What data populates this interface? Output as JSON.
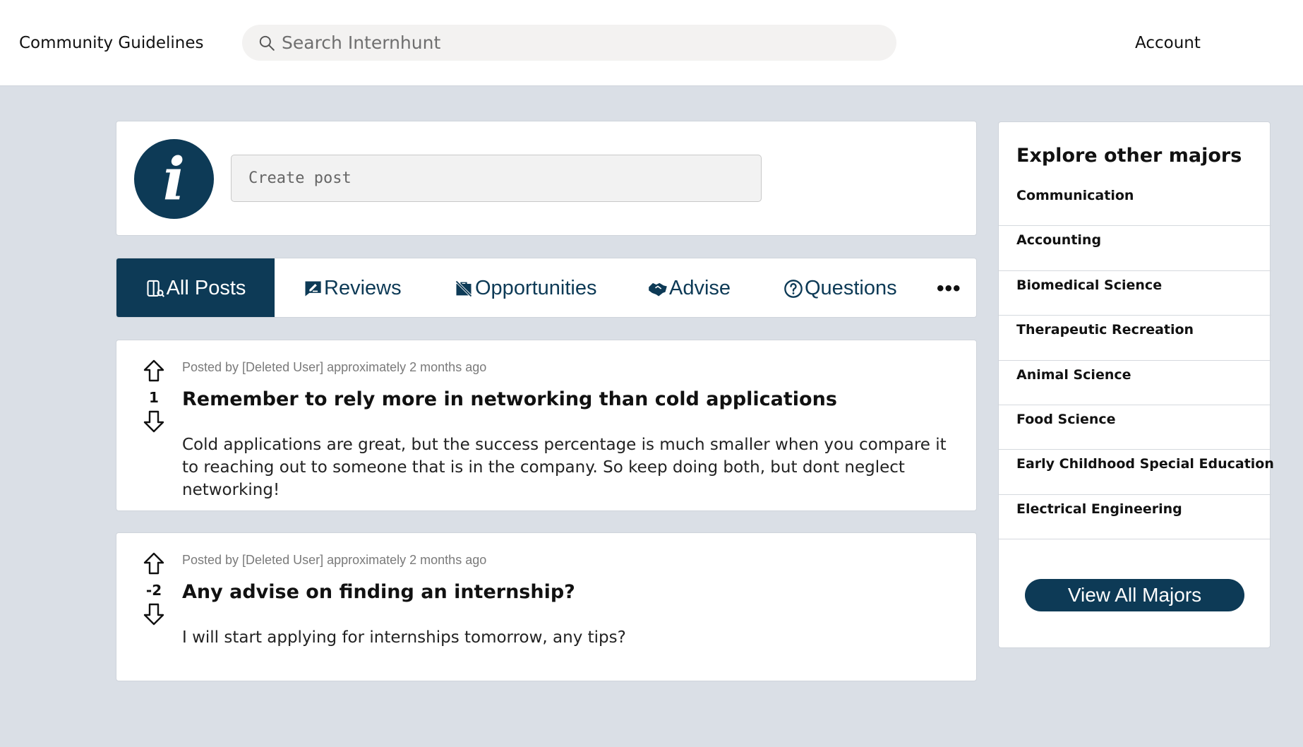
{
  "header": {
    "guidelines_label": "Community Guidelines",
    "search_placeholder": "Search Internhunt",
    "account_label": "Account"
  },
  "create_post": {
    "avatar_glyph": "i",
    "placeholder": "Create post"
  },
  "tabs": [
    {
      "label": "All Posts",
      "icon": "all-posts-icon",
      "active": true
    },
    {
      "label": "Reviews",
      "icon": "review-icon",
      "active": false
    },
    {
      "label": "Opportunities",
      "icon": "briefcase-off-icon",
      "active": false
    },
    {
      "label": "Advise",
      "icon": "handshake-icon",
      "active": false
    },
    {
      "label": "Questions",
      "icon": "question-circle-icon",
      "active": false
    }
  ],
  "more_label": "•••",
  "posts": [
    {
      "meta": "Posted by [Deleted User] approximately 2 months ago",
      "score": "1",
      "title": "Remember to rely more in networking than cold applications",
      "body": "Cold applications are great, but the success percentage is much smaller when you compare it to reaching out to someone that is in the company. So keep doing both, but dont neglect networking!"
    },
    {
      "meta": "Posted by [Deleted User] approximately 2 months ago",
      "score": "-2",
      "title": "Any advise on finding an internship?",
      "body": "I will start applying for internships tomorrow, any tips?"
    }
  ],
  "sidebar": {
    "title": "Explore other majors",
    "majors": [
      "Communication",
      "Accounting",
      "Biomedical Science",
      "Therapeutic Recreation",
      "Animal Science",
      "Food Science",
      "Early Childhood Special Education",
      "Electrical Engineering"
    ],
    "view_all_label": "View All Majors"
  },
  "colors": {
    "brand": "#0d3a56",
    "background": "#dadfe6",
    "card": "#ffffff"
  }
}
